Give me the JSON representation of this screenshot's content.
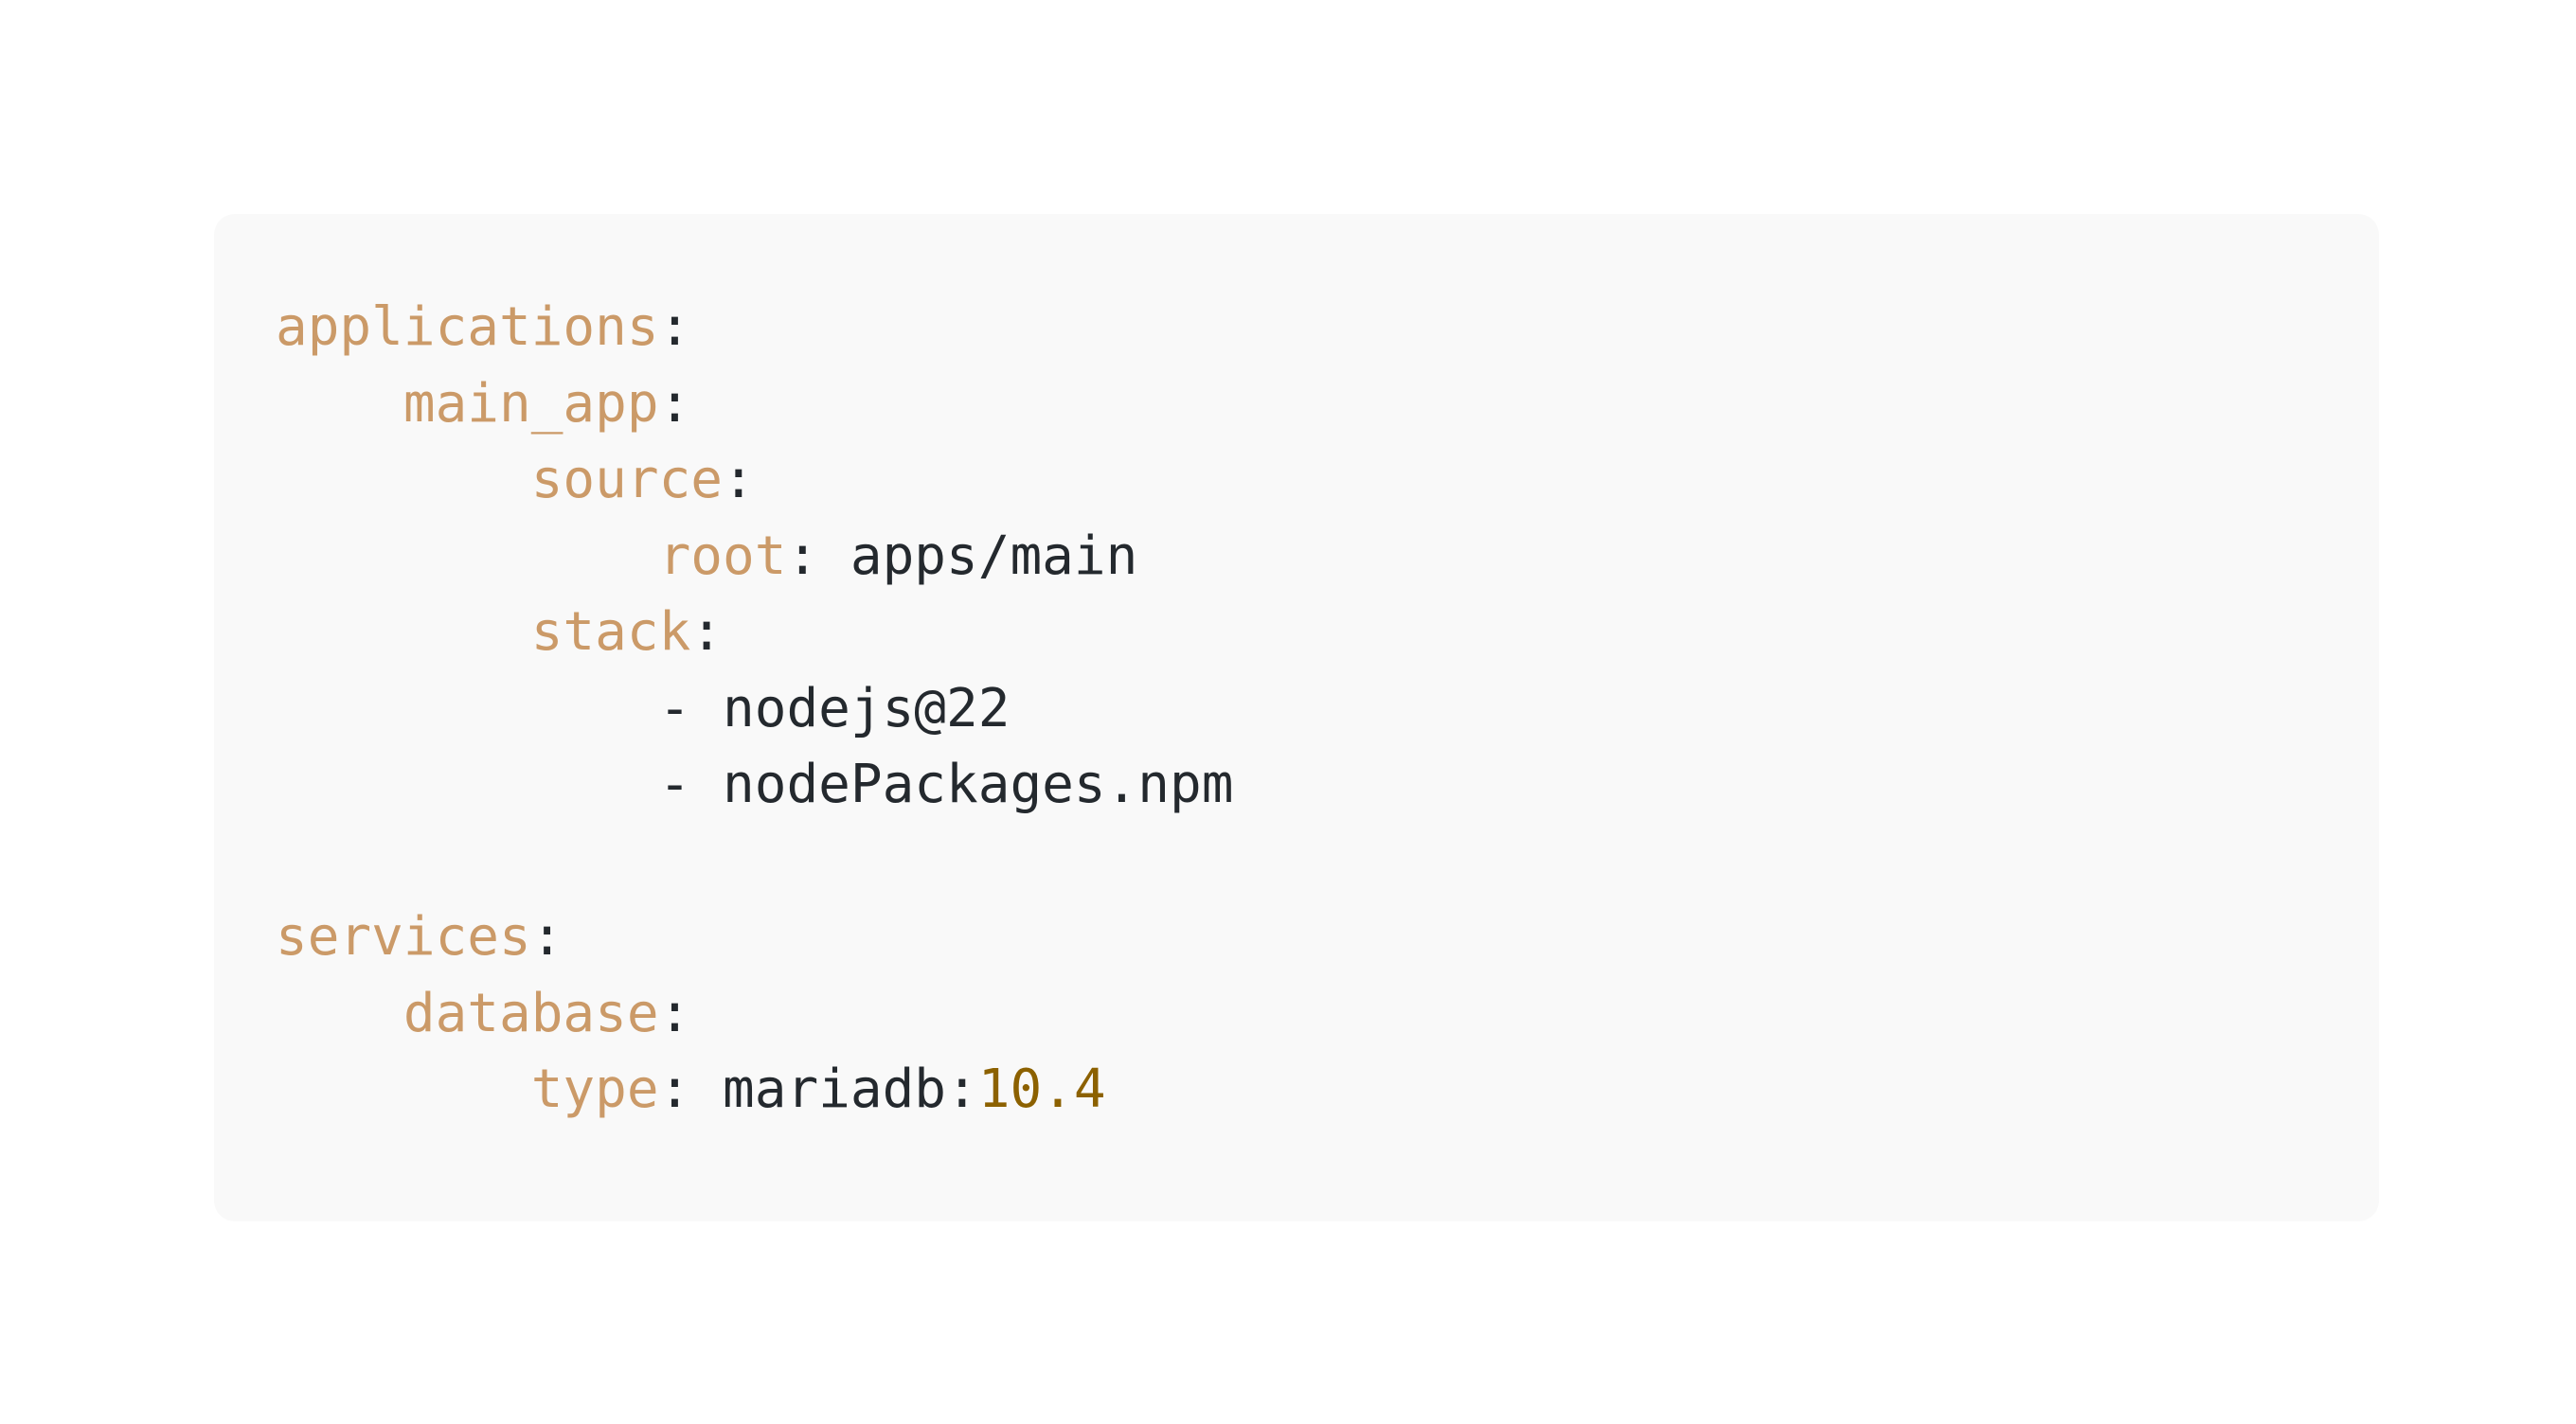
{
  "code_lines": [
    {
      "indent": "",
      "key": "applications",
      "sep": ":",
      "value": "",
      "number": ""
    },
    {
      "indent": "    ",
      "key": "main_app",
      "sep": ":",
      "value": "",
      "number": ""
    },
    {
      "indent": "        ",
      "key": "source",
      "sep": ":",
      "value": "",
      "number": ""
    },
    {
      "indent": "            ",
      "key": "root",
      "sep": ": ",
      "value": "apps/main",
      "number": ""
    },
    {
      "indent": "        ",
      "key": "stack",
      "sep": ":",
      "value": "",
      "number": ""
    },
    {
      "indent": "            ",
      "key": "",
      "sep": "",
      "value": "- nodejs@22",
      "number": ""
    },
    {
      "indent": "            ",
      "key": "",
      "sep": "",
      "value": "- nodePackages.npm",
      "number": ""
    },
    {
      "indent": "",
      "key": "",
      "sep": "",
      "value": "",
      "number": ""
    },
    {
      "indent": "",
      "key": "services",
      "sep": ":",
      "value": "",
      "number": ""
    },
    {
      "indent": "    ",
      "key": "database",
      "sep": ":",
      "value": "",
      "number": ""
    },
    {
      "indent": "        ",
      "key": "type",
      "sep": ": ",
      "value": "mariadb:",
      "number": "10.4"
    }
  ],
  "colors": {
    "key": "#cb9a68",
    "text": "#24292e",
    "number": "#8c6100",
    "panel_bg": "#f9f9f9",
    "page_bg": "#ffffff"
  }
}
